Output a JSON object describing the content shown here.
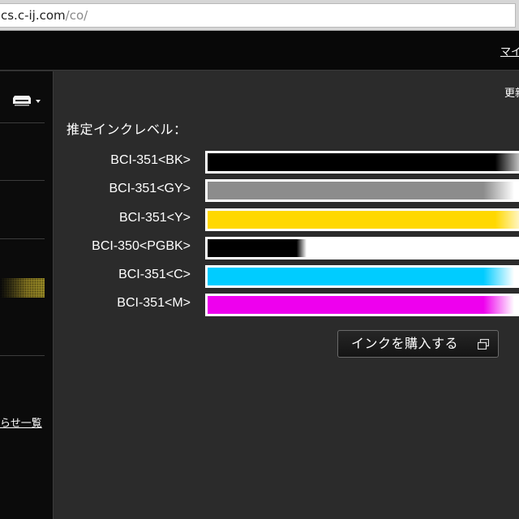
{
  "browser": {
    "url_host": "cs.c-ij.com",
    "url_path": "/co/"
  },
  "header": {
    "top_link": "マイ"
  },
  "sidebar": {
    "news_link": "らせ一覧"
  },
  "main": {
    "update_label": "更新",
    "section_title": "推定インクレベル："
  },
  "ink_levels": [
    {
      "name": "BCI-351<BK>",
      "color": "#000000",
      "level": 1.0
    },
    {
      "name": "BCI-351<GY>",
      "color": "#8c8c8c",
      "level": 0.96
    },
    {
      "name": "BCI-351<Y>",
      "color": "#ffd800",
      "level": 1.0
    },
    {
      "name": "BCI-350<PGBK>",
      "color": "#000000",
      "level": 0.31
    },
    {
      "name": "BCI-351<C>",
      "color": "#00ccff",
      "level": 0.96
    },
    {
      "name": "BCI-351<M>",
      "color": "#ee00ee",
      "level": 0.96
    }
  ],
  "buy_button": {
    "label": "インクを購入する"
  },
  "icons": {
    "printer": "printer-icon",
    "dropdown": "chevron-down-icon",
    "external": "external-window-icon"
  }
}
